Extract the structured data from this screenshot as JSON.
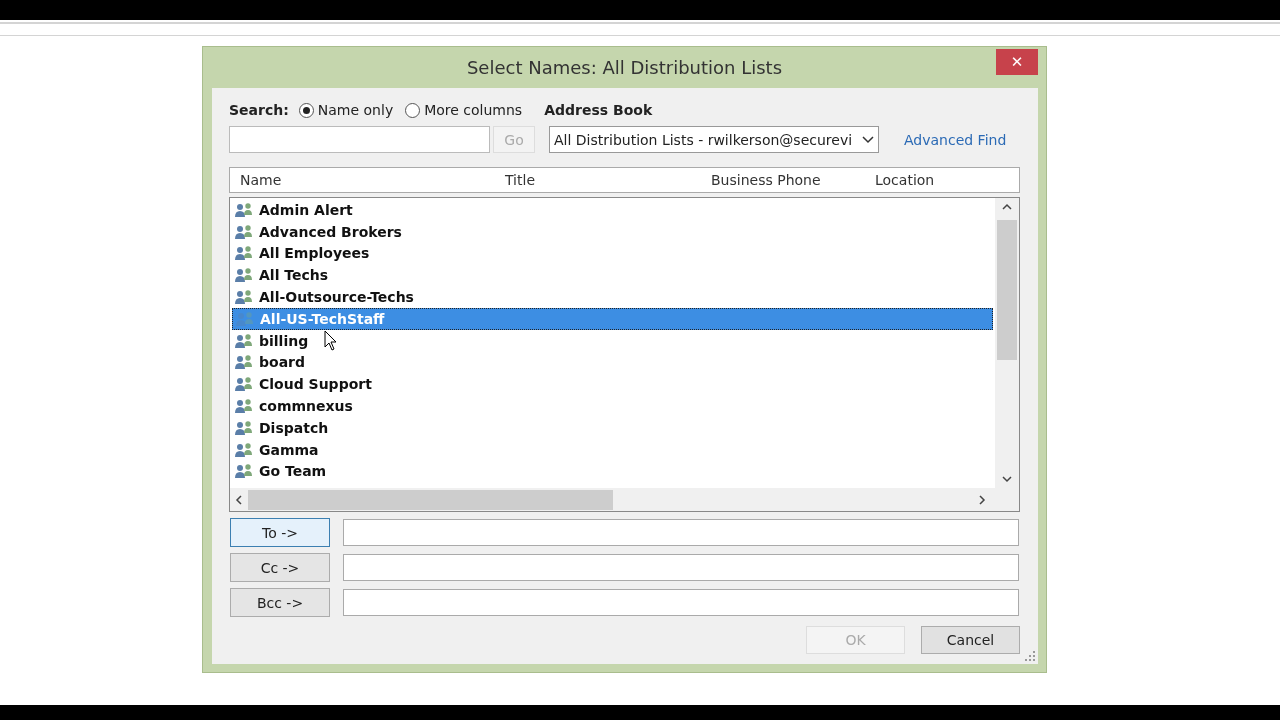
{
  "window": {
    "title": "Select Names: All Distribution Lists",
    "close": "✕"
  },
  "search": {
    "label": "Search:",
    "options": [
      {
        "label": "Name only",
        "selected": true
      },
      {
        "label": "More columns",
        "selected": false
      }
    ],
    "go": "Go"
  },
  "address_book": {
    "label": "Address Book",
    "value": "All Distribution Lists - rwilkerson@securevi",
    "link": "Advanced Find"
  },
  "table": {
    "columns": [
      "Name",
      "Title",
      "Business Phone",
      "Location"
    ],
    "rows": [
      {
        "name": "Admin Alert",
        "selected": false
      },
      {
        "name": "Advanced Brokers",
        "selected": false
      },
      {
        "name": "All Employees",
        "selected": false
      },
      {
        "name": "All Techs",
        "selected": false
      },
      {
        "name": "All-Outsource-Techs",
        "selected": false
      },
      {
        "name": "All-US-TechStaff",
        "selected": true
      },
      {
        "name": "billing",
        "selected": false
      },
      {
        "name": "board",
        "selected": false
      },
      {
        "name": "Cloud Support",
        "selected": false
      },
      {
        "name": "commnexus",
        "selected": false
      },
      {
        "name": "Dispatch",
        "selected": false
      },
      {
        "name": "Gamma",
        "selected": false
      },
      {
        "name": "Go Team",
        "selected": false
      }
    ]
  },
  "recipients": [
    {
      "label": "To ->",
      "focused": true
    },
    {
      "label": "Cc ->",
      "focused": false
    },
    {
      "label": "Bcc ->",
      "focused": false
    }
  ],
  "buttons": [
    {
      "label": "OK",
      "disabled": true
    },
    {
      "label": "Cancel",
      "disabled": false
    }
  ]
}
